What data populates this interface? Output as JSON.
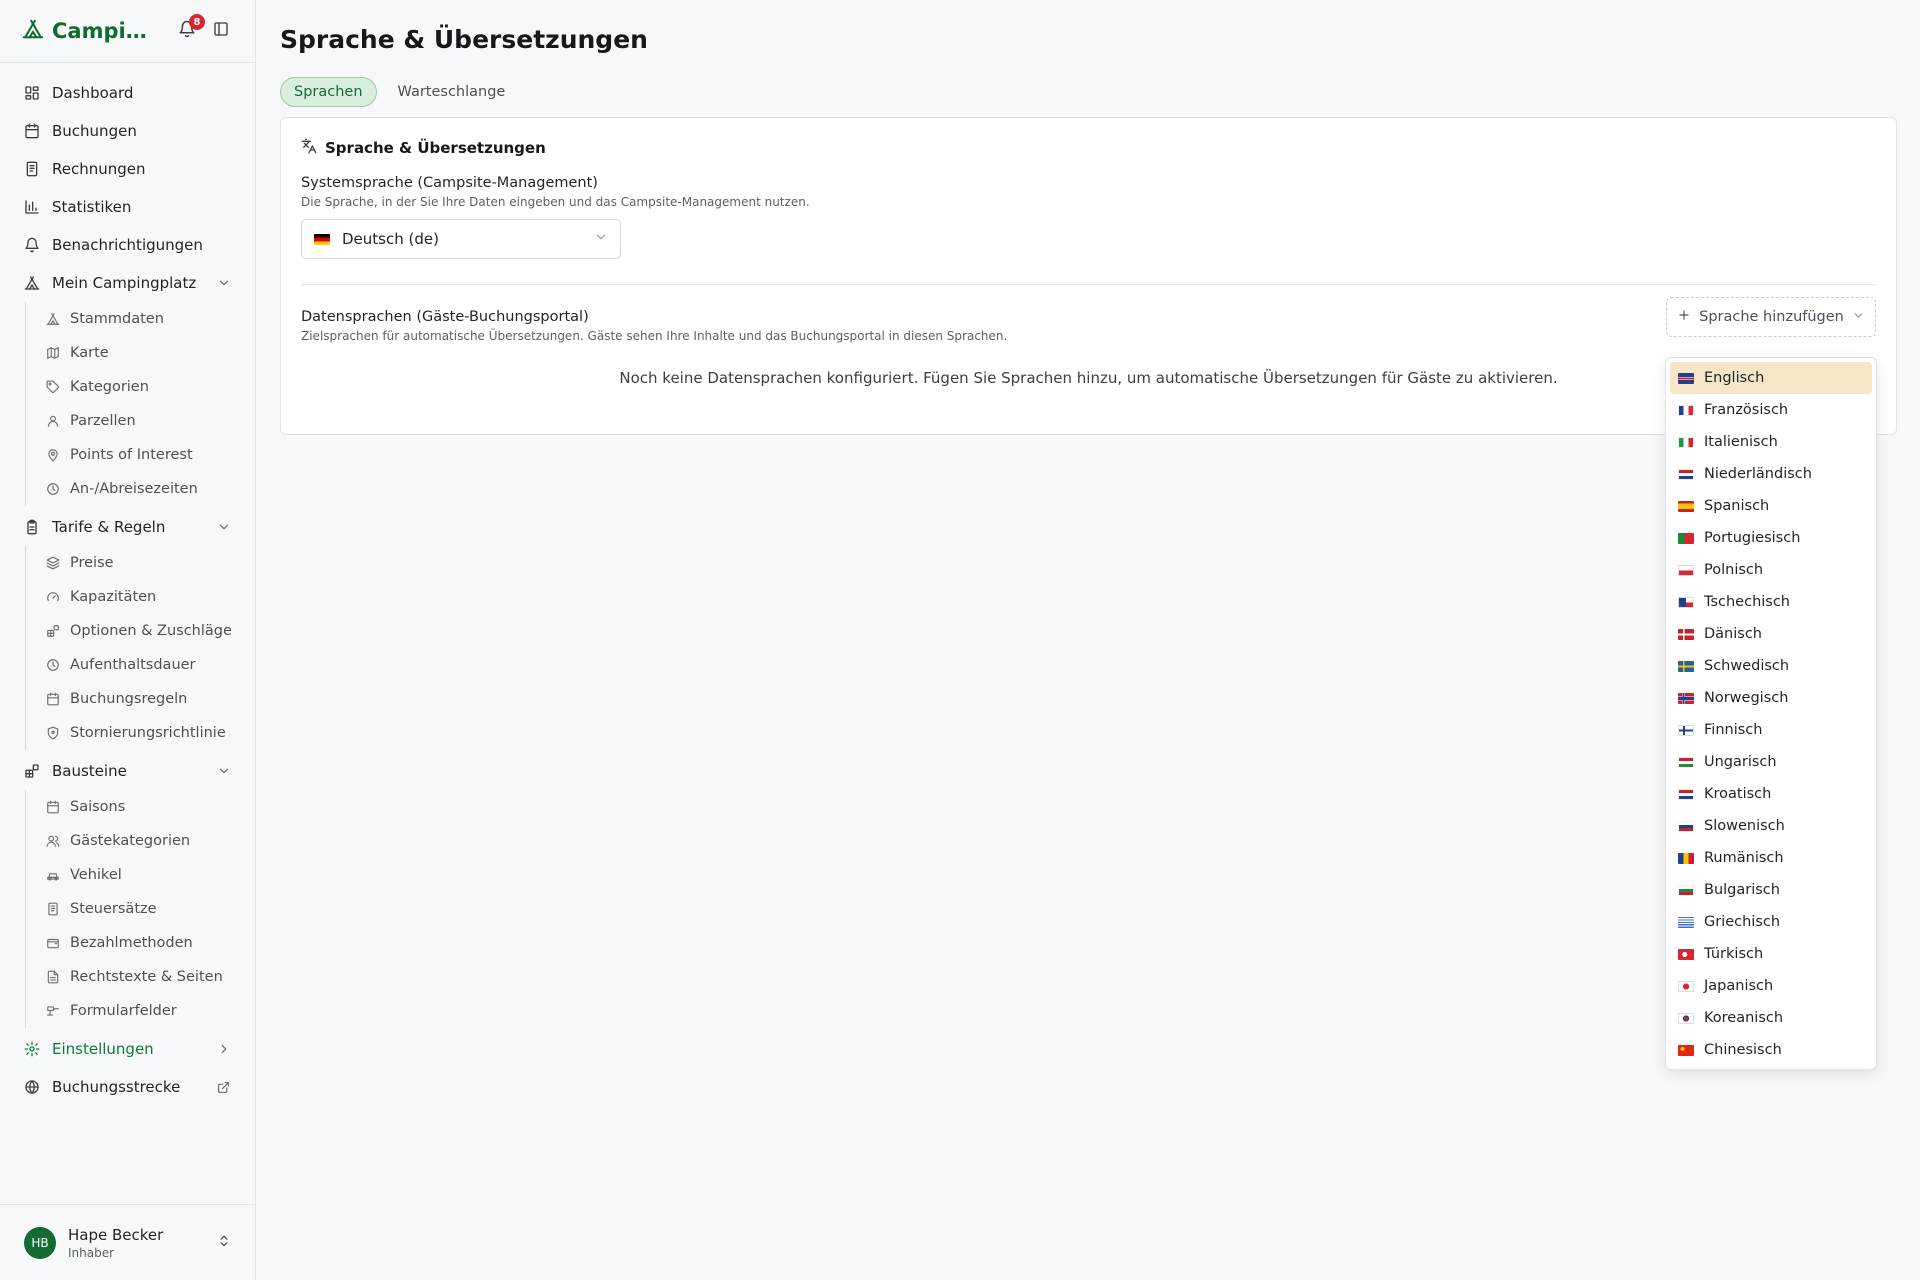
{
  "app": {
    "brand": "Campingplatz",
    "notification_count": "8"
  },
  "sidebar": {
    "items": [
      {
        "label": "Dashboard",
        "icon": "dashboard-icon"
      },
      {
        "label": "Buchungen",
        "icon": "calendar-icon"
      },
      {
        "label": "Rechnungen",
        "icon": "receipt-icon"
      },
      {
        "label": "Statistiken",
        "icon": "bar-chart-icon"
      },
      {
        "label": "Benachrichtigungen",
        "icon": "bell-icon"
      }
    ],
    "groups": [
      {
        "label": "Mein Campingplatz",
        "icon": "tent-icon",
        "children": [
          {
            "label": "Stammdaten",
            "icon": "tent-icon"
          },
          {
            "label": "Karte",
            "icon": "map-icon"
          },
          {
            "label": "Kategorien",
            "icon": "tag-icon"
          },
          {
            "label": "Parzellen",
            "icon": "user-icon"
          },
          {
            "label": "Points of Interest",
            "icon": "pin-icon"
          },
          {
            "label": "An-/Abreisezeiten",
            "icon": "clock-icon"
          }
        ]
      },
      {
        "label": "Tarife & Regeln",
        "icon": "clipboard-icon",
        "children": [
          {
            "label": "Preise",
            "icon": "layers-icon"
          },
          {
            "label": "Kapazitäten",
            "icon": "gauge-icon"
          },
          {
            "label": "Optionen & Zuschläge",
            "icon": "blocks-icon"
          },
          {
            "label": "Aufenthaltsdauer",
            "icon": "clock-icon"
          },
          {
            "label": "Buchungsregeln",
            "icon": "calendar-icon"
          },
          {
            "label": "Stornierungsrichtlinie",
            "icon": "shield-icon"
          }
        ]
      },
      {
        "label": "Bausteine",
        "icon": "blocks-icon",
        "children": [
          {
            "label": "Saisons",
            "icon": "calendar-icon"
          },
          {
            "label": "Gästekategorien",
            "icon": "users-icon"
          },
          {
            "label": "Vehikel",
            "icon": "car-icon"
          },
          {
            "label": "Steuersätze",
            "icon": "receipt-icon"
          },
          {
            "label": "Bezahlmethoden",
            "icon": "wallet-icon"
          },
          {
            "label": "Rechtstexte & Seiten",
            "icon": "document-icon"
          },
          {
            "label": "Formularfelder",
            "icon": "form-icon"
          }
        ]
      }
    ],
    "settings_label": "Einstellungen",
    "booking_label": "Buchungsstrecke"
  },
  "user": {
    "initials": "HB",
    "name": "Hape Becker",
    "role": "Inhaber"
  },
  "page": {
    "title": "Sprache & Übersetzungen",
    "tabs": [
      {
        "label": "Sprachen",
        "active": true
      },
      {
        "label": "Warteschlange",
        "active": false
      }
    ]
  },
  "card": {
    "title": "Sprache & Übersetzungen",
    "system_label": "Systemsprache (Campsite-Management)",
    "system_desc": "Die Sprache, in der Sie Ihre Daten eingeben und das Campsite-Management nutzen.",
    "system_value": "Deutsch (de)",
    "data_label": "Datensprachen (Gäste-Buchungsportal)",
    "data_desc": "Zielsprachen für automatische Übersetzungen. Gäste sehen Ihre Inhalte und das Buchungsportal in diesen Sprachen.",
    "add_button": "Sprache hinzufügen",
    "empty_message": "Noch keine Datensprachen konfiguriert. Fügen Sie Sprachen hinzu, um automatische Übersetzungen für Gäste zu aktivieren."
  },
  "languages": [
    {
      "label": "Englisch",
      "flag": "gb",
      "highlighted": true
    },
    {
      "label": "Französisch",
      "flag": "fr"
    },
    {
      "label": "Italienisch",
      "flag": "it"
    },
    {
      "label": "Niederländisch",
      "flag": "nl"
    },
    {
      "label": "Spanisch",
      "flag": "es"
    },
    {
      "label": "Portugiesisch",
      "flag": "pt"
    },
    {
      "label": "Polnisch",
      "flag": "pl"
    },
    {
      "label": "Tschechisch",
      "flag": "cz"
    },
    {
      "label": "Dänisch",
      "flag": "dk"
    },
    {
      "label": "Schwedisch",
      "flag": "se"
    },
    {
      "label": "Norwegisch",
      "flag": "no"
    },
    {
      "label": "Finnisch",
      "flag": "fi"
    },
    {
      "label": "Ungarisch",
      "flag": "hu"
    },
    {
      "label": "Kroatisch",
      "flag": "hr"
    },
    {
      "label": "Slowenisch",
      "flag": "si"
    },
    {
      "label": "Rumänisch",
      "flag": "ro"
    },
    {
      "label": "Bulgarisch",
      "flag": "bg"
    },
    {
      "label": "Griechisch",
      "flag": "gr"
    },
    {
      "label": "Türkisch",
      "flag": "tr"
    },
    {
      "label": "Japanisch",
      "flag": "jp"
    },
    {
      "label": "Koreanisch",
      "flag": "kr"
    },
    {
      "label": "Chinesisch",
      "flag": "cn"
    }
  ],
  "colors": {
    "brand": "#0f6b2f",
    "accent": "#0f7a3a",
    "tab_active_bg": "#d9eedd",
    "highlight": "#f5e6c8",
    "badge": "#d7262f"
  }
}
